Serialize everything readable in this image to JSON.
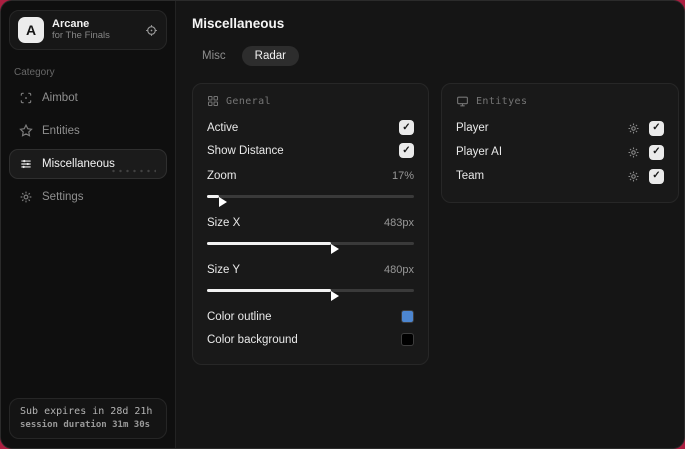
{
  "brand": {
    "initial": "A",
    "name": "Arcane",
    "subtitle": "for The Finals"
  },
  "sidebar": {
    "category_label": "Category",
    "items": [
      {
        "label": "Aimbot"
      },
      {
        "label": "Entities"
      },
      {
        "label": "Miscellaneous"
      },
      {
        "label": "Settings"
      }
    ],
    "footer": {
      "sub_expiry": "Sub expires in 28d 21h",
      "session_duration": "session duration 31m 30s"
    }
  },
  "main": {
    "title": "Miscellaneous",
    "tabs": [
      {
        "label": "Misc",
        "active": false
      },
      {
        "label": "Radar",
        "active": true
      }
    ],
    "general": {
      "title": "General",
      "active": {
        "label": "Active",
        "checked": true
      },
      "show_distance": {
        "label": "Show Distance",
        "checked": true
      },
      "zoom": {
        "label": "Zoom",
        "value": "17%",
        "fill": "6%"
      },
      "size_x": {
        "label": "Size X",
        "value": "483px",
        "fill": "60%"
      },
      "size_y": {
        "label": "Size Y",
        "value": "480px",
        "fill": "60%"
      },
      "color_outline": {
        "label": "Color outline",
        "color": "#4d86d0"
      },
      "color_background": {
        "label": "Color background",
        "color": "#000000"
      }
    },
    "entities": {
      "title": "Entityes",
      "rows": [
        {
          "label": "Player",
          "checked": true
        },
        {
          "label": "Player AI",
          "checked": true
        },
        {
          "label": "Team",
          "checked": true
        }
      ]
    }
  },
  "colors": {
    "accent_background": "#ab1e40",
    "outline_swatch": "#4d86d0",
    "background_swatch": "#000000"
  }
}
